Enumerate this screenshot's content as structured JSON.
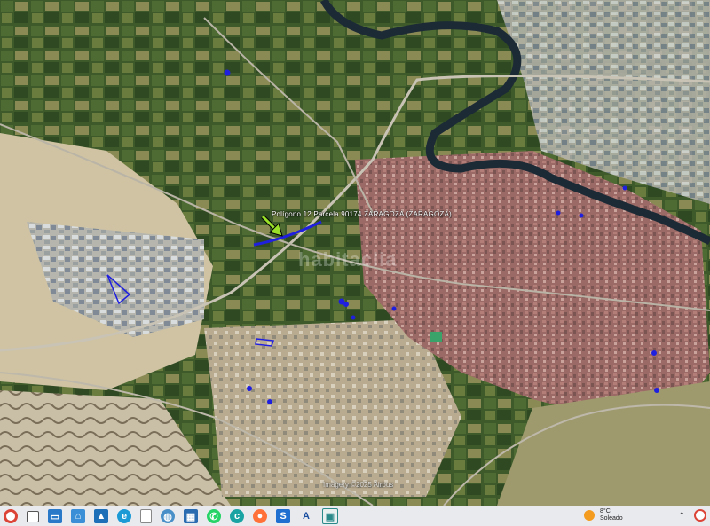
{
  "map": {
    "marker_label": "Polígono 12 Parcela 90174 ZARAGOZA (ZARAGOZA)",
    "watermark": "habitaclia",
    "attribution": "Imagery ©2025 Airbus"
  },
  "colors": {
    "parcel_highlight": "#1f1fe0",
    "marker_arrow": "#9be028",
    "river": "#1c2a36"
  },
  "taskbar": {
    "icons": [
      "chrome-icon",
      "desktop-icon",
      "explorer-icon",
      "network-icon",
      "photos-icon",
      "edge-icon",
      "file-icon",
      "globe-icon",
      "calculator-icon",
      "whatsapp-icon",
      "copilot-icon",
      "firefox-icon",
      "sketchup-icon",
      "archicad-icon",
      "viewer-icon"
    ],
    "weather": {
      "temperature": "8°C",
      "condition": "Soleado"
    }
  }
}
